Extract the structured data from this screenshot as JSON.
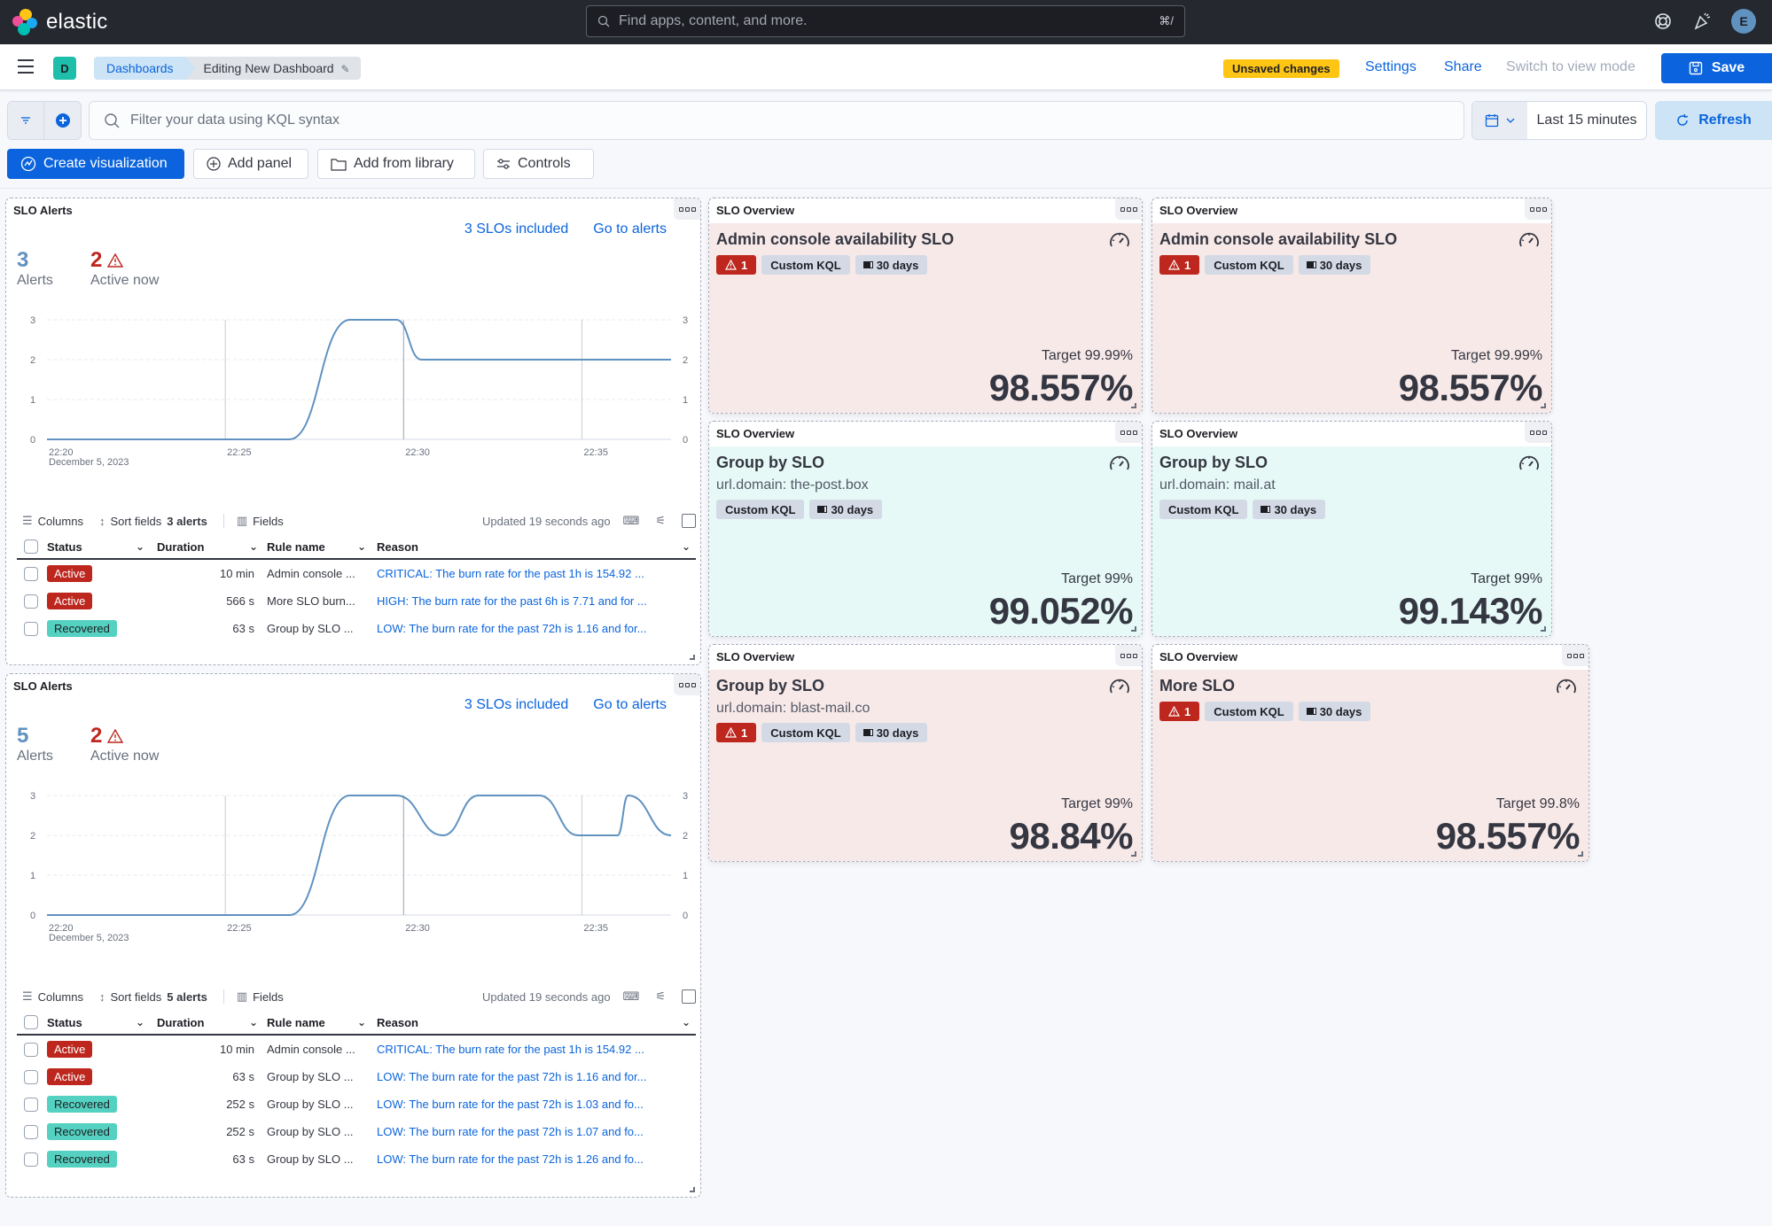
{
  "header": {
    "brand": "elastic",
    "search_placeholder": "Find apps, content, and more.",
    "search_shortcut": "⌘/",
    "avatar_initial": "E"
  },
  "nav": {
    "space_initial": "D",
    "breadcrumbs": [
      "Dashboards",
      "Editing New Dashboard"
    ],
    "unsaved_badge": "Unsaved changes",
    "settings": "Settings",
    "share": "Share",
    "switch_mode": "Switch to view mode",
    "save": "Save"
  },
  "query": {
    "kql_placeholder": "Filter your data using KQL syntax",
    "time_range": "Last 15 minutes",
    "refresh": "Refresh"
  },
  "toolbar": {
    "create_visualization": "Create visualization",
    "add_panel": "Add panel",
    "add_from_library": "Add from library",
    "controls": "Controls"
  },
  "colors": {
    "primary": "#0b64dd",
    "danger": "#bd271e",
    "success": "#54d1c0",
    "warning": "#fec514",
    "line": "#6092c0"
  },
  "alert_panels": [
    {
      "title": "SLO Alerts",
      "slos_included": "3 SLOs included",
      "go_to_alerts": "Go to alerts",
      "alerts_count": "3",
      "alerts_label": "Alerts",
      "active_count": "2",
      "active_label": "Active now",
      "toolbar": {
        "columns": "Columns",
        "sort_fields": "Sort fields",
        "alert_count": "3 alerts",
        "fields": "Fields",
        "updated": "Updated 19 seconds ago"
      },
      "columns": [
        "Status",
        "Duration",
        "Rule name",
        "Reason"
      ],
      "rows": [
        {
          "status": "Active",
          "duration": "10 min",
          "rule": "Admin console ...",
          "reason": "CRITICAL: The burn rate for the past 1h is 154.92 ..."
        },
        {
          "status": "Active",
          "duration": "566 s",
          "rule": "More SLO burn...",
          "reason": "HIGH: The burn rate for the past 6h is 7.71 and for ..."
        },
        {
          "status": "Recovered",
          "duration": "63 s",
          "rule": "Group by SLO ...",
          "reason": "LOW: The burn rate for the past 72h is 1.16 and for..."
        }
      ]
    },
    {
      "title": "SLO Alerts",
      "slos_included": "3 SLOs included",
      "go_to_alerts": "Go to alerts",
      "alerts_count": "5",
      "alerts_label": "Alerts",
      "active_count": "2",
      "active_label": "Active now",
      "toolbar": {
        "columns": "Columns",
        "sort_fields": "Sort fields",
        "alert_count": "5 alerts",
        "fields": "Fields",
        "updated": "Updated 19 seconds ago"
      },
      "columns": [
        "Status",
        "Duration",
        "Rule name",
        "Reason"
      ],
      "rows": [
        {
          "status": "Active",
          "duration": "10 min",
          "rule": "Admin console ...",
          "reason": "CRITICAL: The burn rate for the past 1h is 154.92 ..."
        },
        {
          "status": "Active",
          "duration": "63 s",
          "rule": "Group by SLO ...",
          "reason": "LOW: The burn rate for the past 72h is 1.16 and for..."
        },
        {
          "status": "Recovered",
          "duration": "252 s",
          "rule": "Group by SLO ...",
          "reason": "LOW: The burn rate for the past 72h is 1.03 and fo..."
        },
        {
          "status": "Recovered",
          "duration": "252 s",
          "rule": "Group by SLO ...",
          "reason": "LOW: The burn rate for the past 72h is 1.07 and fo..."
        },
        {
          "status": "Recovered",
          "duration": "63 s",
          "rule": "Group by SLO ...",
          "reason": "LOW: The burn rate for the past 72h is 1.26 and fo..."
        }
      ]
    }
  ],
  "chart_data": [
    {
      "type": "line",
      "title": "",
      "x_ticks": [
        "22:20",
        "22:25",
        "22:30",
        "22:35"
      ],
      "x_sublabel": "December 5, 2023",
      "x_range_minutes": [
        0,
        17.5
      ],
      "y_ticks": [
        0,
        1,
        2,
        3
      ],
      "ylim": [
        0,
        3
      ],
      "grid": true,
      "series": [
        {
          "name": "alerts",
          "x": [
            0,
            5,
            6.8,
            8.5,
            9.8,
            10.5,
            11.5,
            17.5
          ],
          "values": [
            0,
            0,
            0,
            3,
            3,
            2,
            2,
            2
          ]
        }
      ]
    },
    {
      "type": "line",
      "title": "",
      "x_ticks": [
        "22:20",
        "22:25",
        "22:30",
        "22:35"
      ],
      "x_sublabel": "December 5, 2023",
      "x_range_minutes": [
        0,
        17.5
      ],
      "y_ticks": [
        0,
        1,
        2,
        3
      ],
      "ylim": [
        0,
        3
      ],
      "grid": true,
      "series": [
        {
          "name": "alerts",
          "x": [
            0,
            5,
            6.8,
            8.5,
            9.8,
            11.1,
            12.1,
            13.8,
            14.9,
            16.0,
            16.3,
            17.5
          ],
          "values": [
            0,
            0,
            0,
            3,
            3,
            2,
            3,
            3,
            2,
            2,
            3,
            2
          ]
        }
      ]
    }
  ],
  "slo_cards": [
    {
      "header": "SLO Overview",
      "name": "Admin console availability SLO",
      "sub": "",
      "alerts": "1",
      "type_tag": "Custom KQL",
      "window_tag": "30 days",
      "target": "Target 99.99%",
      "value": "98.557%",
      "state": "bad"
    },
    {
      "header": "SLO Overview",
      "name": "Admin console availability SLO",
      "sub": "",
      "alerts": "1",
      "type_tag": "Custom KQL",
      "window_tag": "30 days",
      "target": "Target 99.99%",
      "value": "98.557%",
      "state": "bad"
    },
    {
      "header": "SLO Overview",
      "name": "Group by SLO",
      "sub": "url.domain: the-post.box",
      "alerts": "",
      "type_tag": "Custom KQL",
      "window_tag": "30 days",
      "target": "Target 99%",
      "value": "99.052%",
      "state": "good"
    },
    {
      "header": "SLO Overview",
      "name": "Group by SLO",
      "sub": "url.domain: mail.at",
      "alerts": "",
      "type_tag": "Custom KQL",
      "window_tag": "30 days",
      "target": "Target 99%",
      "value": "99.143%",
      "state": "good"
    },
    {
      "header": "SLO Overview",
      "name": "Group by SLO",
      "sub": "url.domain: blast-mail.co",
      "alerts": "1",
      "type_tag": "Custom KQL",
      "window_tag": "30 days",
      "target": "Target 99%",
      "value": "98.84%",
      "state": "bad"
    },
    {
      "header": "SLO Overview",
      "name": "More SLO",
      "sub": "",
      "alerts": "1",
      "type_tag": "Custom KQL",
      "window_tag": "30 days",
      "target": "Target 99.8%",
      "value": "98.557%",
      "state": "bad"
    }
  ]
}
